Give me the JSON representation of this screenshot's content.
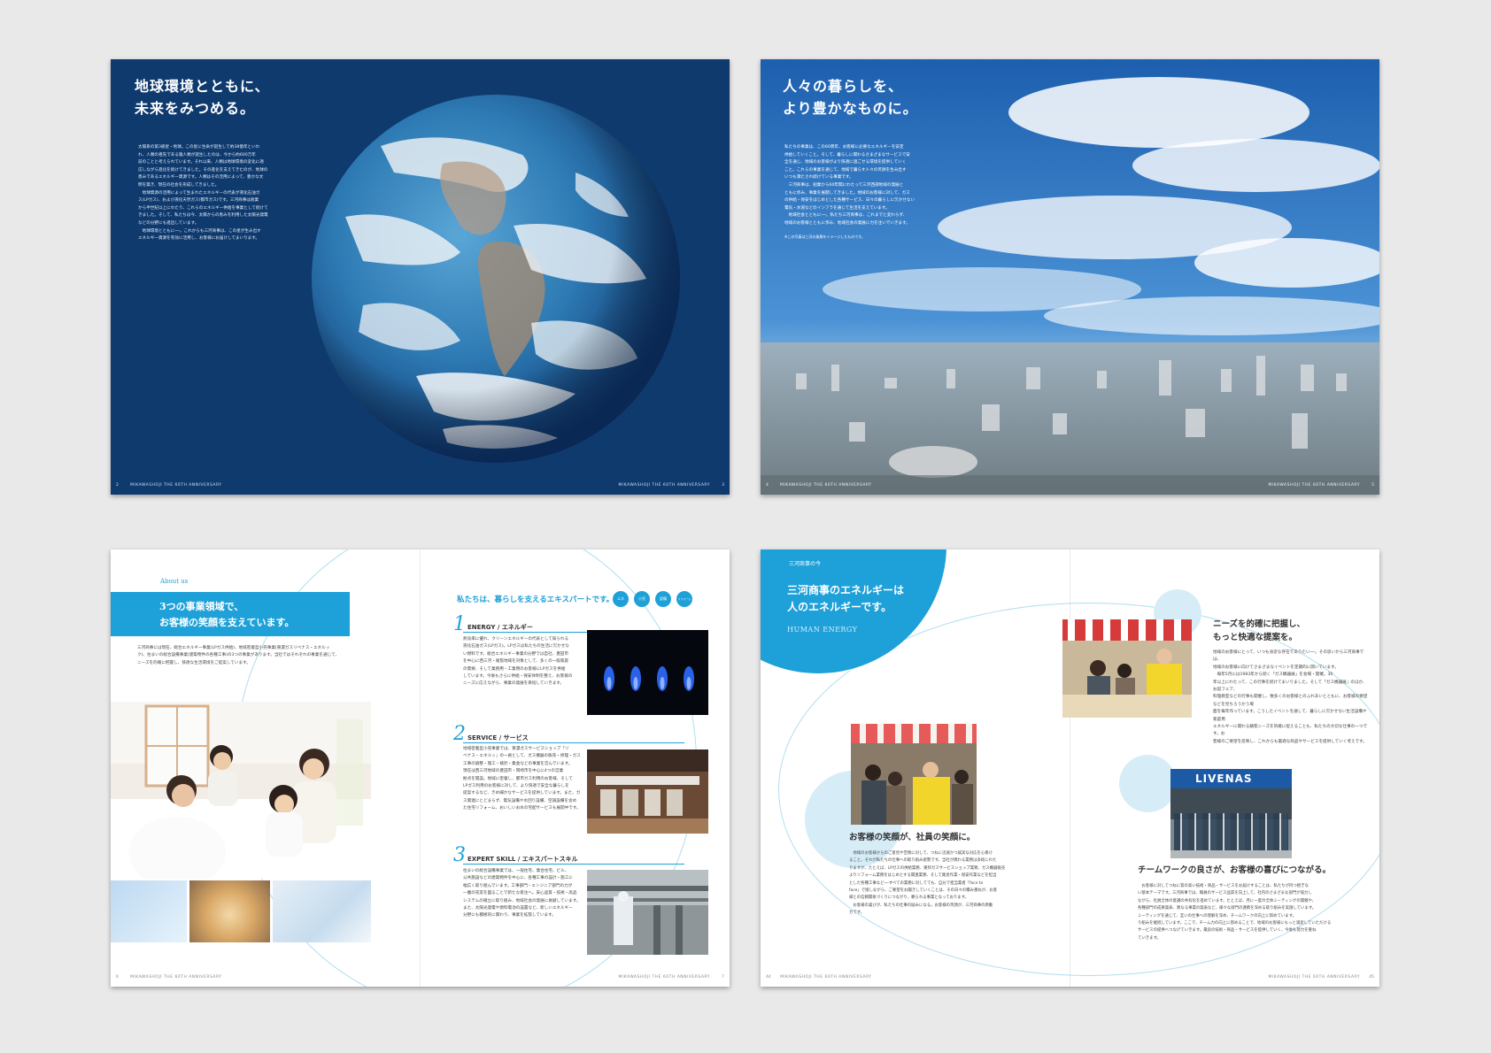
{
  "footer": {
    "text": "MIKAWASHOJI THE 60TH ANNIVERSARY",
    "pages": [
      "2",
      "3",
      "4",
      "5",
      "6",
      "7",
      "44",
      "45"
    ]
  },
  "spread1": {
    "heading": [
      "地球環境とともに、",
      "未来をみつめる。"
    ],
    "body": [
      "太陽系の第3惑星・地球。この星に生命が誕生して約38億年といわ",
      "れ、人類の祖先である猿人類が誕生したのは、今から約600万年",
      "前のことと考えられています。それ以来、人類は地球環境の変化に適",
      "応しながら進化を続けてきました。その進化を支えてきたのが、地球の",
      "恵みであるエネルギー資源です。人類はその活用によって、豊かな文",
      "明を築き、現在の社会を形成してきました。",
      "　地球資源の活用によって生まれたエネルギーの代表が液化石油ガ",
      "ス(LPガス)、および液化天然ガス(都市ガス)です。三河商事は創業",
      "から半世紀以上にわたり、これらのエネルギー供給を事業として続けて",
      "きました。そして、私たちは今、太陽からの恵みを利用した太陽光発電",
      "などの分野にも進出しています。",
      "　地球環境とともに──。これからも三河商事は、この星が生み出す",
      "エネルギー資源を有効に活用し、お客様にお届けしてまいります。"
    ]
  },
  "spread2": {
    "heading": [
      "人々の暮らしを、",
      "より豊かなものに。"
    ],
    "body": [
      "私たちの事業は、この60周年、お客様に必要なエネルギーを安定",
      "供給していくこと。そして、暮らしに関わるさまざまなサービスで安",
      "全を通じ、地域のお客様がより快適に過ごせる環境を提供していく",
      "こと。これらの事業を通じて、地域で暮らす人々の笑顔を生み出す",
      "いつも満たされ続けている事業です。",
      "　三河商事は、創業から60年間にわたって三河西部地域の発展と",
      "ともに歩み、事業を展開してきました。地域のお客様に対して、ガス",
      "の供給・保安をはじめとした各種サービス、日々の暮らしに欠かせない",
      "電気・水道などのインフラを通じて生活を支えています。",
      "　地域社会とともに──。私たち三河商事は、これまでと変わらず、",
      "地域のお客様とともに歩み、地域社会の発展に力を注いでいきます。"
    ],
    "note": "※この写真は三河の風景をイメージしたものです。"
  },
  "spread3": {
    "about_label": "About us",
    "heading": [
      "3つの事業領域で、",
      "お客様の笑顔を支えています。"
    ],
    "intro": [
      "三河商事には現在、総合エネルギー事業(LPガス供給)、地域密着型小売事業(東濃ガスリベナス・エネルッ",
      "ク)、住まいの総合設備事業(建築物件の各種工事)の3つの事業があります。当社ではそれぞれの事業を通じて、",
      "ニーズを的確に把握し、快適な生活環境をご提案しています。"
    ],
    "right_heading": "私たちは、暮らしを支えるエキスパートです。",
    "bubbles": [
      "エネ",
      "小売",
      "設備",
      "リフォーム"
    ],
    "sections": [
      {
        "num": "1",
        "title": "ENERGY / エネルギー",
        "body": [
          "熱効率に優れ、クリーンエネルギーの代表として知られる",
          "液化石油ガス(LPガス)。LPガスは私たちの生活に欠かせな",
          "い燃料です。総合エネルギー事業の分野では自社、豊田市",
          "を中心に西三河・尾張地域を対象として、多くの一般家庭",
          "の需要、そして業務用・工業用のお客様にLPガスを供給",
          "しています。今後もさらに供給・保安体制を整え、お客様の",
          "ニーズに応えながら、事業の発展を目指していきます。"
        ]
      },
      {
        "num": "2",
        "title": "SERVICE / サービス",
        "body": [
          "地域密着型小売事業では、東濃ガスサービスショップ「リ",
          "ベナス・エネルッ」の一員として、ガス機器の販売・修理・ガス",
          "工事の調整・施工・検針・集金などの事業を営んでいます。",
          "現在は西三河地域の豊田市・岡崎市を中心に4つの営業",
          "拠点を開設。地域に密着し、都市ガス利用のお客様、そして",
          "LPガス利用のお客様に対して、より快適で安全な暮らしを",
          "提案するなど、きめ細かなサービスを提供しています。また、ガ",
          "ス関連にとどまらず、電気設備や水回り設備、空調設備を含め",
          "た住宅リフォーム、おいしいお水の宅配サービスも展開中です。"
        ]
      },
      {
        "num": "3",
        "title": "EXPERT SKILL / エキスパートスキル",
        "body": [
          "住まいの総合設備事業では、一般住宅、集合住宅、ビル、",
          "公共施設などの建築物件を中心に、各種工事の設計・施工に",
          "幅広く取り組んでいます。工事部門・エンジニア部門の力が",
          "一層の充実を図ることで新たな受注へ。安心品質・技術・高品",
          "システムの確立に取り組み、地域社会の発展に貢献しています。",
          "また、太陽光発電や燃料電池の設置など、新しいエネルギー",
          "分野にも積極的に関わり、事業を拡張しています。"
        ]
      }
    ]
  },
  "spread4": {
    "section_label": "三河商事の今",
    "heading": [
      "三河商事のエネルギーは",
      "人のエネルギーです。"
    ],
    "subheading": "HUMAN ENERGY",
    "cap1": [
      "ニーズを的確に把握し、",
      "もっと快適な提案を。"
    ],
    "body1": [
      "地域のお客様にとって、いつも身近な存在でありたい──。その思いから三河商事では、",
      "地域のお客様に向けてさまざまなイベントを定期的に開いています。",
      "　毎年5月には1983年から続く「ガス機器展」を会場・開催。30",
      "年以上にわたって、この行事を続けてまいりました。そして「ガス機器展」のほか、お誕フェア、",
      "料理教室などの行事も開催し、数多くのお客様とのふれあいとともに、お客様の要望などを見ちろうかう場",
      "面を毎年作っています。こうしたイベントを通して、暮らしに欠かせない生活設備や家庭用",
      "エネルギーに関わる顧客ニーズを的確に捉えることも、私たちの大切な仕事の一つです。お",
      "客様のご要望を反映し、これからも最適な商品やサービスを提供していく考えです。"
    ],
    "cap2": "お客様の笑顔が、社員の笑顔に。",
    "body2": [
      "　地域のお客様からのご意見や苦情に対して、つねに迅速かつ誠実な対応を心掛け",
      "ること。それが私たちの仕事への取り組み姿勢です。当社が携わる業務は多岐にわた",
      "りますが、たとえば、LPガスの供給業務、東邦ガスサービスショップ業務、ガス機器販売",
      "よりリフォーム業務をはじめとする関連業務、そして集金作業・保安作業などを担当",
      "とした各種工事など──すべての業務に対してても、自分で担当業者「face to",
      "face」で接しながら、ご要望をお聞きしていくことは、その日々の積み重ねが、お客",
      "様との信頼関係づくりにつながり、頼られる事業となっております。",
      "　お客様の喜びが、私たちの仕事の励みになる。お客様の笑顔が、三河商事の原動",
      "力です。"
    ],
    "store_sign": "LIVENAS",
    "cap3": "チームワークの良さが、お客様の喜びにつながる。",
    "body3": [
      "　お客様に対してつねに質の高い技術・商品・サービスをお届けすることは、私たちが持つ揺ぎな",
      "い基本テーマです。三河商事では、職員のサービス品質を向上して、社内のさまざまな部門が協力し",
      "ながら、社員全体の意識の共有化を進めています。たとえば、月に一度の全体ミーティングの開催や、",
      "各種部門の成果発表、異なる事業の発表など、様々な部門の連携を深める取り組みを実施しています。",
      "ミーティングを通じて、互いの仕事への理解を深め、チームワークの向上に努めています。",
      "り組みを継続しています。ここで、チーム力の向上に努めることで、地域のお客様にもっと満足していただける",
      "サービスの提供へつなげていきます。最良の技術・商品・サービスを提供していく、今後も努力を重ね",
      "ていきます。"
    ]
  }
}
